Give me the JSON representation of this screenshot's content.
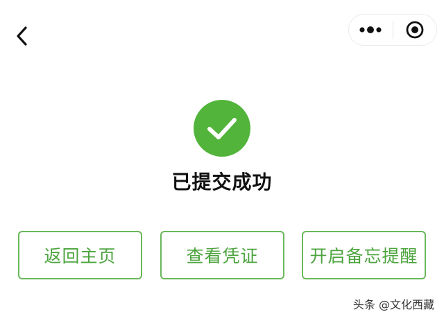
{
  "nav": {
    "back_icon": "chevron-left-icon",
    "capsule": {
      "more_icon": "more-dots-icon",
      "close_icon": "target-close-icon"
    }
  },
  "result": {
    "icon": "check-circle-icon",
    "color": "#52b43a",
    "title": "已提交成功"
  },
  "actions": {
    "home_label": "返回主页",
    "voucher_label": "查看凭证",
    "reminder_label": "开启备忘提醒",
    "accent_color": "#4da43f"
  },
  "watermark": {
    "text": "头条 @文化西藏"
  }
}
